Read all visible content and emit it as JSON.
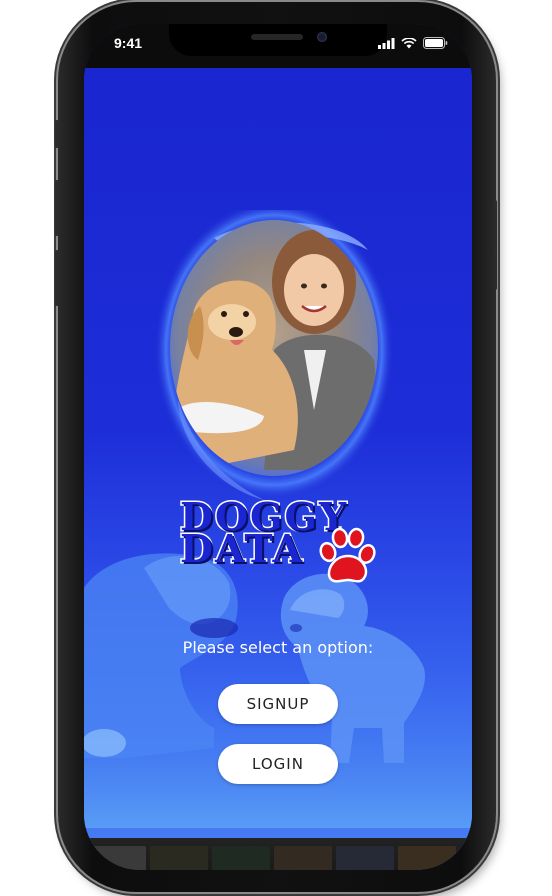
{
  "status_bar": {
    "time": "9:41"
  },
  "app": {
    "logo_line1": "DOGGY",
    "logo_line2": "DATA",
    "prompt": "Please select an option:",
    "signup_label": "SIGNUP",
    "login_label": "LOGIN"
  },
  "colors": {
    "background": "#1f2cc8",
    "button": "#ffffff",
    "paw": "#e0141e"
  },
  "icons": [
    "signal-icon",
    "wifi-icon",
    "battery-icon",
    "paw-icon"
  ]
}
